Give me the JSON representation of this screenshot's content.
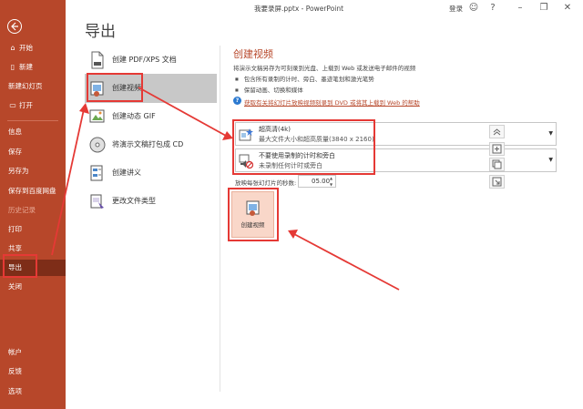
{
  "titlebar": {
    "title": "我要录屏.pptx  -  PowerPoint",
    "login": "登录"
  },
  "sidebar": {
    "items": [
      {
        "label": "开始",
        "icon": "home-icon"
      },
      {
        "label": "新建",
        "icon": "new-file-icon"
      },
      {
        "label": "新建幻灯页"
      },
      {
        "label": "打开",
        "icon": "folder-icon"
      },
      {
        "label": "信息"
      },
      {
        "label": "保存"
      },
      {
        "label": "另存为"
      },
      {
        "label": "保存到百度网盘"
      },
      {
        "label": "历史记录"
      },
      {
        "label": "打印"
      },
      {
        "label": "共享"
      },
      {
        "label": "导出"
      },
      {
        "label": "关闭"
      },
      {
        "label": "帐户"
      },
      {
        "label": "反馈"
      },
      {
        "label": "选项"
      }
    ]
  },
  "page": {
    "title": "导出"
  },
  "options": [
    {
      "label": "创建 PDF/XPS 文档"
    },
    {
      "label": "创建视频"
    },
    {
      "label": "创建动态 GIF"
    },
    {
      "label": "将演示文稿打包成 CD"
    },
    {
      "label": "创建讲义"
    },
    {
      "label": "更改文件类型"
    }
  ],
  "panel": {
    "title": "创建视频",
    "desc": "将演示文稿另存为可刻录到光盘、上载到 Web 或发送电子邮件的视频",
    "bullets": [
      "包含所有录制的计时、旁白、墨迹笔划和激光笔势",
      "保留动画、切换和媒体"
    ],
    "help_link": "获取有关将幻灯片放映视频刻录到 DVD 或将其上载到 Web 的帮助",
    "quality": {
      "line1": "超高清(4k)",
      "line2": "最大文件大小和超高质量(3840 x 2160)"
    },
    "timing": {
      "line1": "不要使用录制的计时和旁白",
      "line2": "未录制任何计时或旁白"
    },
    "seconds_label": "放映每张幻灯片的秒数:",
    "seconds_value": "05.00",
    "create_button": "创建视频"
  },
  "colors": {
    "brand": "#b7472a",
    "annotation": "#e53935"
  }
}
